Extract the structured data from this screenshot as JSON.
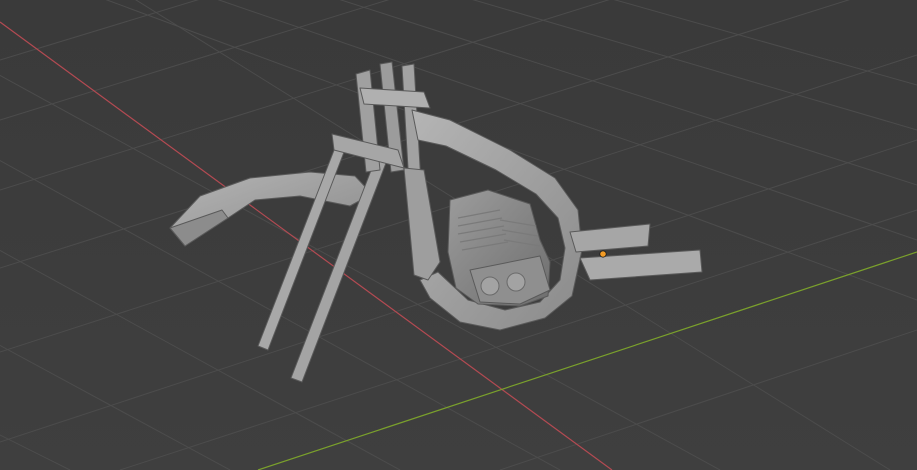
{
  "viewport": {
    "background": "#3d3d3d",
    "grid_color": "#4a4a4a",
    "x_axis_color": "#b34a52",
    "y_axis_color": "#7aa02c",
    "origin_color": "#f29b25"
  },
  "model": {
    "object_type": "mesh",
    "shading": "solid",
    "base_color": "#9a9a9a",
    "light_color": "#b8b8b8",
    "dark_color": "#6a6a6a"
  }
}
